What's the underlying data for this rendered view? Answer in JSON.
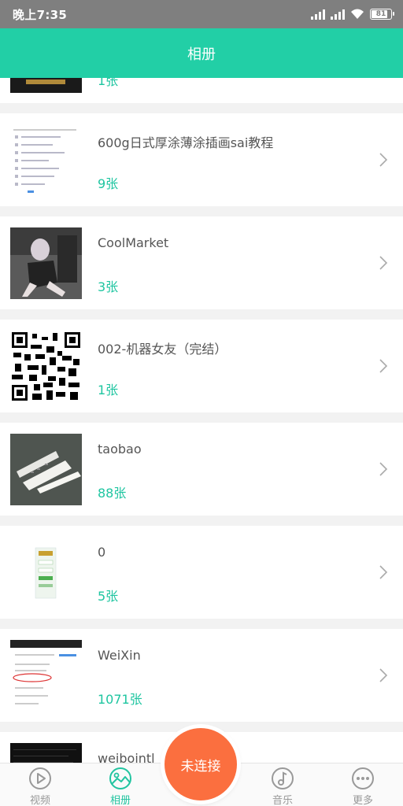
{
  "status": {
    "time": "晚上7:35",
    "battery": "81"
  },
  "header": {
    "title": "相册"
  },
  "albums": [
    {
      "name": "",
      "count": "1张"
    },
    {
      "name": "600g日式厚涂薄涂插画sai教程",
      "count": "9张"
    },
    {
      "name": "CoolMarket",
      "count": "3张"
    },
    {
      "name": "002-机器女友（完结）",
      "count": "1张"
    },
    {
      "name": "taobao",
      "count": "88张"
    },
    {
      "name": "0",
      "count": "5张"
    },
    {
      "name": "WeiXin",
      "count": "1071张"
    },
    {
      "name": "weibointl_i",
      "count": ""
    }
  ],
  "nav": {
    "video": "视频",
    "album": "相册",
    "music": "音乐",
    "more": "更多"
  },
  "connect_button": "未连接",
  "colors": {
    "accent": "#22cfa6",
    "connect": "#fb6f3f"
  }
}
